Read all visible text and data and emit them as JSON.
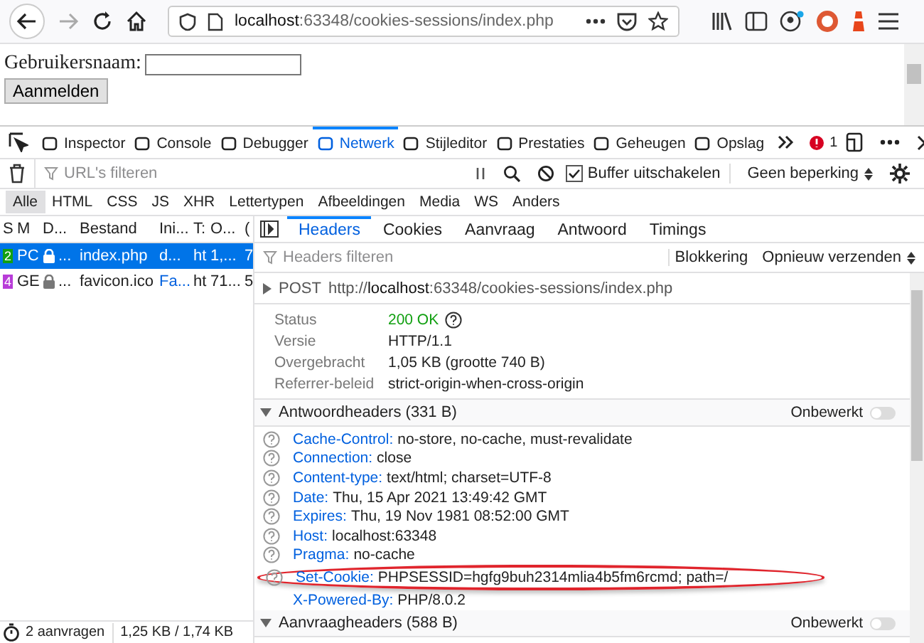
{
  "browser": {
    "url_host": "localhost",
    "url_rest": ":63348/cookies-sessions/index.php"
  },
  "page": {
    "label": "Gebruikersnaam:",
    "button": "Aanmelden"
  },
  "devtools_tabs": [
    {
      "label": "Inspector",
      "selected": false
    },
    {
      "label": "Console",
      "selected": false
    },
    {
      "label": "Debugger",
      "selected": false
    },
    {
      "label": "Netwerk",
      "selected": true
    },
    {
      "label": "Stijleditor",
      "selected": false
    },
    {
      "label": "Prestaties",
      "selected": false
    },
    {
      "label": "Geheugen",
      "selected": false
    },
    {
      "label": "Opslag",
      "selected": false
    }
  ],
  "error_count": "1",
  "filter": {
    "placeholder": "URL's filteren",
    "buffer_label": "Buffer uitschakelen",
    "buffer_checked": true,
    "throttle": "Geen beperking"
  },
  "type_filters": [
    {
      "label": "Alle",
      "selected": true
    },
    {
      "label": "HTML",
      "selected": false
    },
    {
      "label": "CSS",
      "selected": false
    },
    {
      "label": "JS",
      "selected": false
    },
    {
      "label": "XHR",
      "selected": false
    },
    {
      "label": "Lettertypen",
      "selected": false
    },
    {
      "label": "Afbeeldingen",
      "selected": false
    },
    {
      "label": "Media",
      "selected": false
    },
    {
      "label": "WS",
      "selected": false
    },
    {
      "label": "Anders",
      "selected": false
    }
  ],
  "requests": {
    "columns": [
      "S",
      "M",
      "D...",
      "Bestand",
      "Ini...",
      "T:",
      "O...",
      "("
    ],
    "rows": [
      {
        "selected": true,
        "status": "2",
        "color": "#12a012",
        "method": "PC",
        "domain": "...",
        "file": "index.php",
        "initiator": "d...",
        "type": "ht",
        "transferred": "1,...",
        "size": "7"
      },
      {
        "selected": false,
        "status": "4",
        "color": "#b83cd8",
        "method": "GE",
        "domain": "...",
        "file": "favicon.ico",
        "initiator": "Fa...",
        "type": "ht",
        "transferred": "71...",
        "size": "5"
      }
    ]
  },
  "detail_tabs": [
    {
      "label": "Headers",
      "selected": true
    },
    {
      "label": "Cookies",
      "selected": false
    },
    {
      "label": "Aanvraag",
      "selected": false
    },
    {
      "label": "Antwoord",
      "selected": false
    },
    {
      "label": "Timings",
      "selected": false
    }
  ],
  "headers_filter": {
    "placeholder": "Headers filteren",
    "blocking": "Blokkering",
    "resend": "Opnieuw verzenden"
  },
  "request_line": {
    "method": "POST",
    "url_prefix": "http://",
    "url_host": "localhost",
    "url_rest": ":63348/cookies-sessions/index.php"
  },
  "summary": [
    {
      "label": "Status",
      "value": "200 OK",
      "kind": "status"
    },
    {
      "label": "Versie",
      "value": "HTTP/1.1",
      "kind": "text"
    },
    {
      "label": "Overgebracht",
      "value": "1,05 KB (grootte 740 B)",
      "kind": "text"
    },
    {
      "label": "Referrer-beleid",
      "value": "strict-origin-when-cross-origin",
      "kind": "text"
    }
  ],
  "response_headers": {
    "title": "Antwoordheaders (331 B)",
    "expanded": true,
    "raw_label": "Onbewerkt",
    "raw_on": false,
    "items": [
      {
        "name": "Cache-Control:",
        "value": "no-store, no-cache, must-revalidate",
        "help_icon": true,
        "highlighted": false
      },
      {
        "name": "Connection:",
        "value": "close",
        "help_icon": true,
        "highlighted": false
      },
      {
        "name": "Content-type:",
        "value": "text/html; charset=UTF-8",
        "help_icon": true,
        "highlighted": false
      },
      {
        "name": "Date:",
        "value": "Thu, 15 Apr 2021 13:49:42 GMT",
        "help_icon": true,
        "highlighted": false
      },
      {
        "name": "Expires:",
        "value": "Thu, 19 Nov 1981 08:52:00 GMT",
        "help_icon": true,
        "highlighted": false
      },
      {
        "name": "Host:",
        "value": "localhost:63348",
        "help_icon": true,
        "highlighted": false
      },
      {
        "name": "Pragma:",
        "value": "no-cache",
        "help_icon": true,
        "highlighted": false
      },
      {
        "name": "Set-Cookie:",
        "value": "PHPSESSID=hgfg9buh2314mlia4b5fm6rcmd; path=/",
        "help_icon": true,
        "highlighted": true
      },
      {
        "name": "X-Powered-By:",
        "value": "PHP/8.0.2",
        "help_icon": false,
        "highlighted": false
      }
    ]
  },
  "request_headers": {
    "title": "Aanvraagheaders (588 B)",
    "expanded": true,
    "raw_label": "Onbewerkt",
    "raw_on": false
  },
  "status_bar": {
    "requests": "2 aanvragen",
    "transfer": "1,25 KB / 1,74 KB"
  }
}
